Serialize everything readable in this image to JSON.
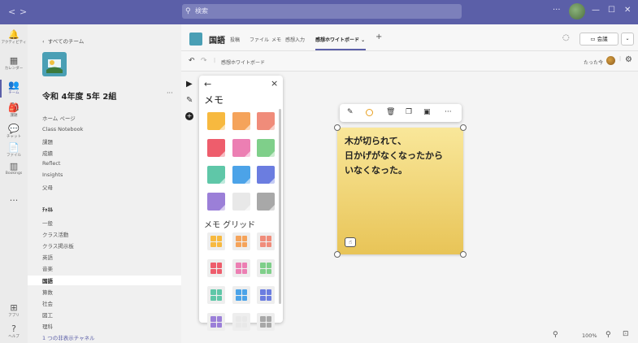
{
  "search": {
    "placeholder": "検索"
  },
  "rail": [
    {
      "label": "アクティビティ",
      "glyph": "🔔"
    },
    {
      "label": "カレンダー",
      "glyph": "▦"
    },
    {
      "label": "チーム",
      "glyph": "👥"
    },
    {
      "label": "課題",
      "glyph": "🎒"
    },
    {
      "label": "チャット",
      "glyph": "💬"
    },
    {
      "label": "ファイル",
      "glyph": "📄"
    },
    {
      "label": "Bookings",
      "glyph": "▥"
    },
    {
      "label": "",
      "glyph": "···"
    },
    {
      "label": "アプリ",
      "glyph": "⊞"
    },
    {
      "label": "ヘルプ",
      "glyph": "?"
    }
  ],
  "leftpane": {
    "back": "すべてのチーム",
    "team_name": "令和 4年度 5年 2組",
    "more": "···",
    "items": [
      "ホーム ページ",
      "Class Notebook",
      "課題",
      "成績",
      "Reflect",
      "Insights",
      "父母"
    ],
    "channels_header": "ﾁｬﾈﾙ",
    "channels": [
      "一般",
      "クラス活動",
      "クラス掲示板",
      "英語",
      "音楽",
      "国語",
      "算数",
      "社会",
      "図工",
      "理科"
    ],
    "hidden": "1 つの非表示チャネル"
  },
  "header": {
    "title": "国語",
    "tabs": [
      "投稿",
      "ファイル",
      "メモ",
      "感想入力",
      "感想ホワイトボード"
    ],
    "add": "+",
    "meet": "会議"
  },
  "whiteboard": {
    "undo": "↶",
    "redo": "↷",
    "name": "感想ホワイトボード",
    "status": "たった今"
  },
  "panel": {
    "back": "←",
    "close": "×",
    "title": "メモ",
    "grid_title": "メモ グリッド",
    "note_colors": [
      "#f7b93f",
      "#f5a35a",
      "#f08c7a",
      "#ee5d6c",
      "#ec7fb3",
      "#7fcf8a",
      "#5fc7a8",
      "#4ca3e8",
      "#6b7de0",
      "#9b7fd8",
      "#e8e8e8",
      "#a8a8a8"
    ]
  },
  "sticky": {
    "text": "木が切られて、\n日かげがなくなったから\nいなくなった。"
  },
  "zoom": {
    "value": "100%"
  }
}
